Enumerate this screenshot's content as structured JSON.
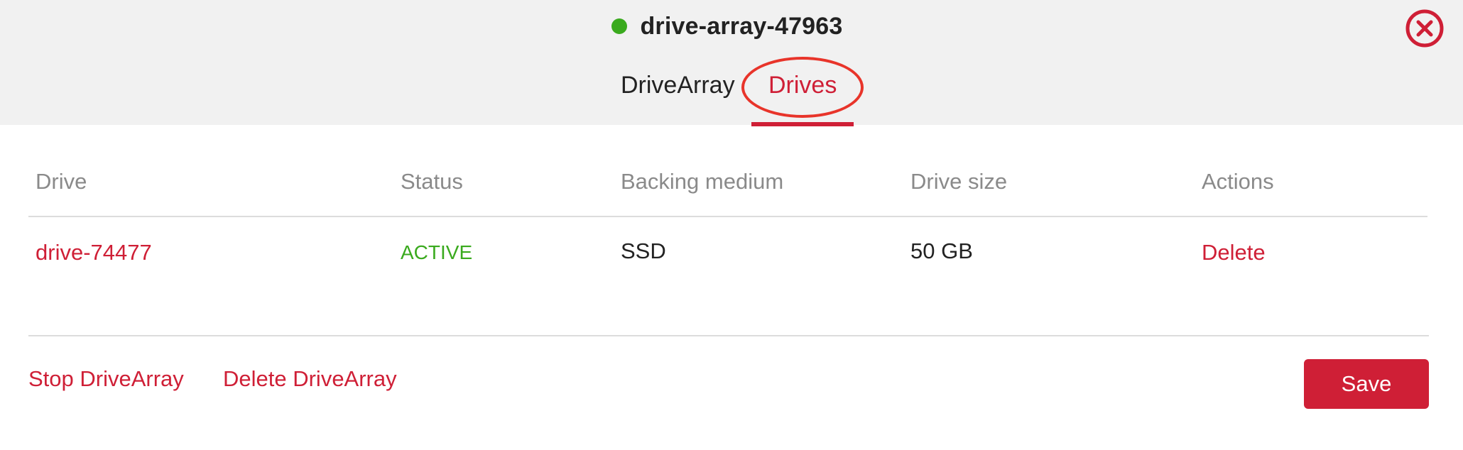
{
  "colors": {
    "accent": "#cf1f36",
    "status_green": "#3aaa1e",
    "header_bg": "#f1f1f1",
    "annotation_red": "#e8342a"
  },
  "header": {
    "title": "drive-array-47963",
    "status_indicator": "green-dot-icon",
    "close_icon": "close-circle-icon"
  },
  "tabs": [
    {
      "label": "DriveArray",
      "active": false
    },
    {
      "label": "Drives",
      "active": true
    }
  ],
  "table": {
    "columns": [
      "Drive",
      "Status",
      "Backing medium",
      "Drive size",
      "Actions"
    ],
    "rows": [
      {
        "drive": "drive-74477",
        "status": "ACTIVE",
        "backing_medium": "SSD",
        "drive_size": "50 GB",
        "action": "Delete"
      }
    ]
  },
  "footer": {
    "stop_label": "Stop DriveArray",
    "delete_label": "Delete DriveArray",
    "save_label": "Save"
  }
}
